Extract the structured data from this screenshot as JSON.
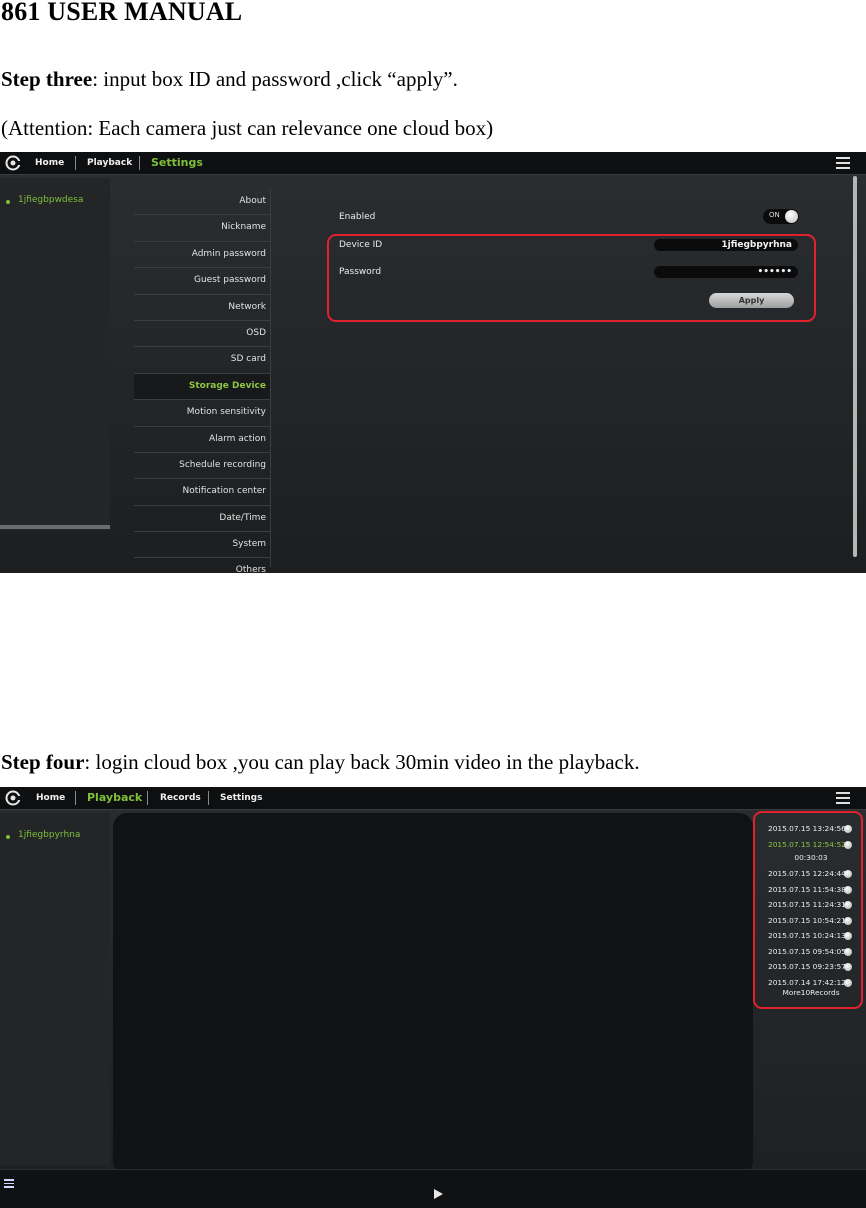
{
  "doc": {
    "title": "861 USER MANUAL",
    "step3_label": "Step three",
    "step3_text": ": input box ID and password ,click “apply”.",
    "attention": "(Attention: Each camera just can relevance one cloud box)",
    "step4_label": "Step four",
    "step4_text": ": login cloud box ,you can play back 30min video in the playback."
  },
  "shot1": {
    "nav": {
      "home": "Home",
      "playback": "Playback",
      "settings": "Settings",
      "active": "Settings"
    },
    "device": "1jfiegbpwdesa",
    "menu": [
      "About",
      "Nickname",
      "Admin password",
      "Guest password",
      "Network",
      "OSD",
      "SD card",
      "Storage Device",
      "Motion sensitivity",
      "Alarm action",
      "Schedule recording",
      "Notification center",
      "Date/Time",
      "System",
      "Others"
    ],
    "selected_menu": "Storage Device",
    "form": {
      "enabled_label": "Enabled",
      "toggle_text": "ON",
      "device_id_label": "Device ID",
      "device_id_value": "1jfiegbpyrhna",
      "password_label": "Password",
      "password_value": "••••••",
      "apply_label": "Apply"
    },
    "highlight_color": "#e0222e",
    "accent_color": "#8cc63f"
  },
  "shot2": {
    "nav": {
      "home": "Home",
      "playback": "Playback",
      "records": "Records",
      "settings": "Settings",
      "active": "Playback"
    },
    "device": "1jfiegbpyrhna",
    "records": [
      "2015.07.15 13:24:56",
      "2015.07.15 12:54:52",
      "2015.07.15 12:24:44",
      "2015.07.15 11:54:38",
      "2015.07.15 11:24:31",
      "2015.07.15 10:54:21",
      "2015.07.15 10:24:13",
      "2015.07.15 09:54:05",
      "2015.07.15 09:23:57",
      "2015.07.14 17:42:12"
    ],
    "selected_record": "2015.07.15 12:54:52",
    "duration": "00:30:03",
    "more": "More10Records"
  }
}
